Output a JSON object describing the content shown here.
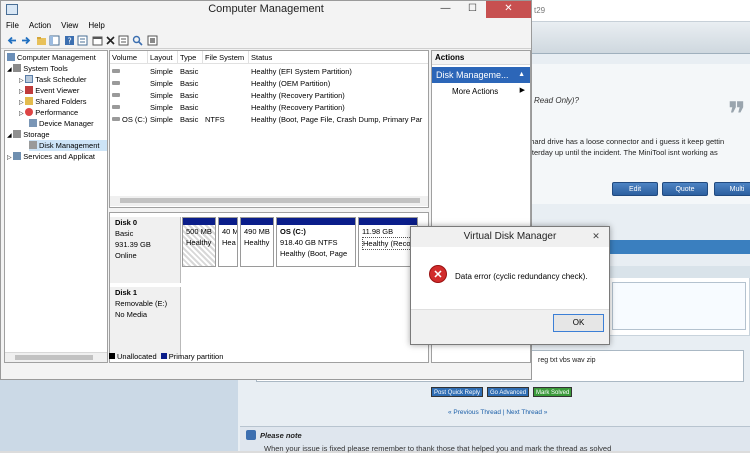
{
  "window": {
    "title": "Computer Management",
    "minimize": "—",
    "maximize": "☐",
    "close": "✕"
  },
  "menu": [
    "File",
    "Action",
    "View",
    "Help"
  ],
  "tree": [
    {
      "label": "Computer Management",
      "indent": 0
    },
    {
      "label": "System Tools",
      "indent": 1
    },
    {
      "label": "Task Scheduler",
      "indent": 2
    },
    {
      "label": "Event Viewer",
      "indent": 2
    },
    {
      "label": "Shared Folders",
      "indent": 2
    },
    {
      "label": "Performance",
      "indent": 2
    },
    {
      "label": "Device Manager",
      "indent": 2
    },
    {
      "label": "Storage",
      "indent": 1
    },
    {
      "label": "Disk Management",
      "indent": 2,
      "selected": true
    },
    {
      "label": "Services and Applicat",
      "indent": 1
    }
  ],
  "volumes": {
    "columns": [
      "Volume",
      "Layout",
      "Type",
      "File System",
      "Status"
    ],
    "rows": [
      [
        "",
        "Simple",
        "Basic",
        "",
        "Healthy (EFI System Partition)"
      ],
      [
        "",
        "Simple",
        "Basic",
        "",
        "Healthy (OEM Partition)"
      ],
      [
        "",
        "Simple",
        "Basic",
        "",
        "Healthy (Recovery Partition)"
      ],
      [
        "",
        "Simple",
        "Basic",
        "",
        "Healthy (Recovery Partition)"
      ],
      [
        "OS (C:)",
        "Simple",
        "Basic",
        "NTFS",
        "Healthy (Boot, Page File, Crash Dump, Primary Par"
      ]
    ]
  },
  "disks": [
    {
      "name": "Disk 0",
      "lines": [
        "Basic",
        "931.39 GB",
        "Online"
      ],
      "partitions": [
        {
          "line1": "500 MB",
          "line2": "Healthy",
          "line3": ""
        },
        {
          "line1": "40 M",
          "line2": "Hea",
          "line3": ""
        },
        {
          "line1": "490 MB",
          "line2": "Healthy",
          "line3": ""
        },
        {
          "line1": "OS  (C:)",
          "line2": "918.40 GB NTFS",
          "line3": "Healthy (Boot, Page"
        },
        {
          "line1": "11.98 GB",
          "line2": "Healthy (Reco",
          "line3": ""
        }
      ]
    },
    {
      "name": "Disk 1",
      "lines": [
        "Removable (E:)",
        "",
        "No Media"
      ]
    }
  ],
  "legend": {
    "unallocated": "Unallocated",
    "primary": "Primary partition"
  },
  "actions": {
    "header": "Actions",
    "selected": "Disk Manageme...",
    "more": "More Actions"
  },
  "dialog": {
    "title": "Virtual Disk Manager",
    "close": "✕",
    "message": "Data error (cyclic redundancy check).",
    "ok": "OK"
  },
  "background": {
    "url_fragment": "t29",
    "read_only": "Read Only)?",
    "line1": "e hard drive has a loose connector and i guess it keep gettin",
    "line2": "esterday up until the incident. The MiniTool isnt working as",
    "buttons": [
      "Edit",
      "Quote",
      "Multi"
    ],
    "exts": "reg txt vbs wav zip",
    "post_buttons": [
      "Post Quick Reply",
      "Go Advanced",
      "Mark Solved"
    ],
    "prev": "« Previous Thread",
    "sep": "|",
    "next": "Next Thread »",
    "note_title": "Please note",
    "note_text": "When your issue is fixed please remember to thank those that helped you and mark the thread as solved"
  },
  "colors": {
    "primary_partition": "#0a1d8a",
    "accent": "#2c66b8",
    "error": "#d12b2b"
  }
}
